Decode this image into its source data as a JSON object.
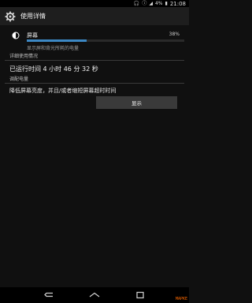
{
  "status_bar": {
    "battery_pct": "4%",
    "clock": "21:08",
    "icons": [
      "headset-icon",
      "info-icon",
      "wifi-icon",
      "battery-icon"
    ]
  },
  "action_bar": {
    "title": "使用详情",
    "icon": "gear-icon"
  },
  "usage": {
    "name": "屏幕",
    "percent": "38%",
    "fraction": 0.38,
    "description": "显示屏和背光所耗的电量",
    "icon": "brightness-icon",
    "bar_color": "#3d88c4"
  },
  "detail": {
    "header": "详细使用情况",
    "line": "已运行时间 4 小时 46 分 32 秒"
  },
  "adjust": {
    "header": "调配电量",
    "text": "降低屏幕亮度，并且/或者缩短屏幕超时时间",
    "button": "显示"
  },
  "nav": {
    "icons": [
      "back-icon",
      "home-icon",
      "recents-icon"
    ]
  },
  "watermark": "MAPKE"
}
